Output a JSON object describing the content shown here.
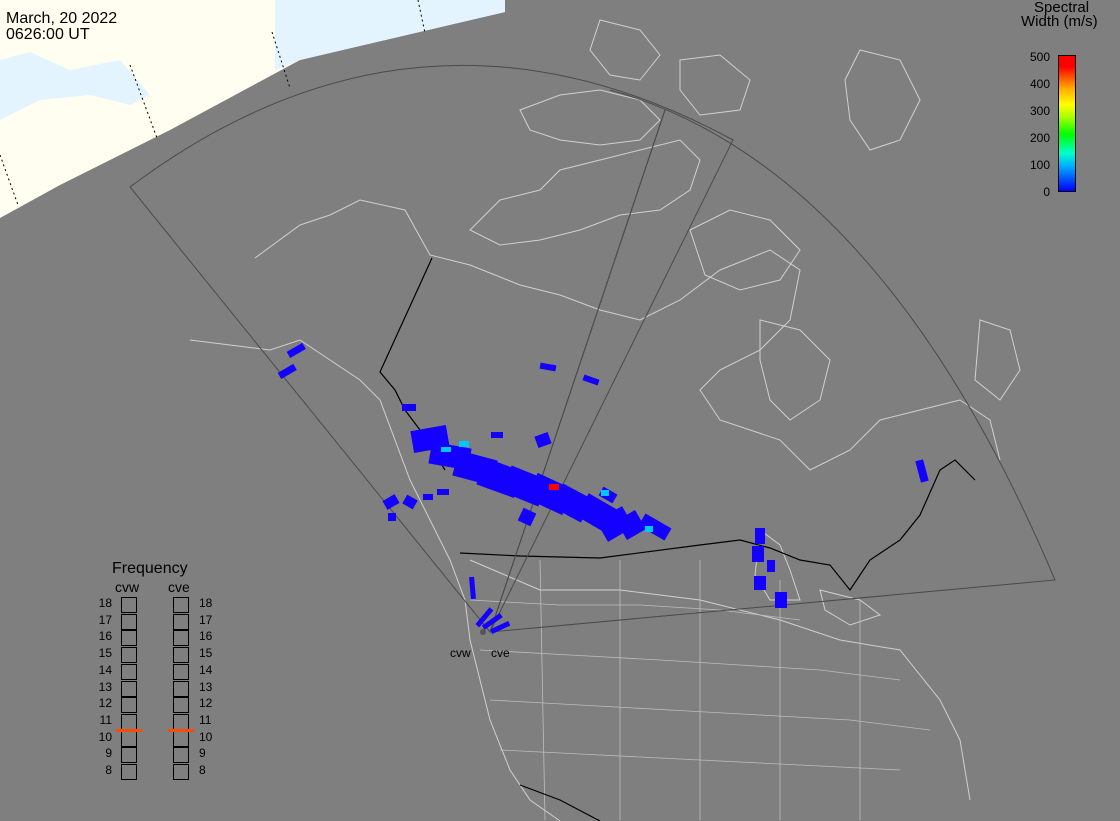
{
  "header": {
    "date": "March, 20 2022",
    "time": "0626:00 UT"
  },
  "colorbar": {
    "title_line1": "Spectral",
    "title_line2": "Width (m/s)",
    "ticks": [
      "500",
      "400",
      "300",
      "200",
      "100",
      "0"
    ],
    "range": [
      0,
      500
    ]
  },
  "frequency_panel": {
    "title": "Frequency",
    "radars": [
      "cvw",
      "cve"
    ],
    "scale": [
      "18",
      "17",
      "16",
      "15",
      "14",
      "13",
      "12",
      "11",
      "10",
      "9",
      "8"
    ],
    "current_frequency_mhz": {
      "cvw": 10.5,
      "cve": 10.5
    }
  },
  "radar_sites": [
    {
      "name": "cvw",
      "label": "cvw"
    },
    {
      "name": "cve",
      "label": "cve"
    }
  ],
  "colors": {
    "ocean_background": "#7f7f7f",
    "daylight_region": "#fffef0",
    "daylight_ice": "#e4f4ff",
    "coastlines": "#d0d0d0",
    "borders": "#000000",
    "fov_outline": "#4a4a4a",
    "echo_low": "#1400ff",
    "echo_mid": "#00c8ff",
    "echo_high": "#ff0000",
    "frequency_marker": "#ff4a00"
  }
}
